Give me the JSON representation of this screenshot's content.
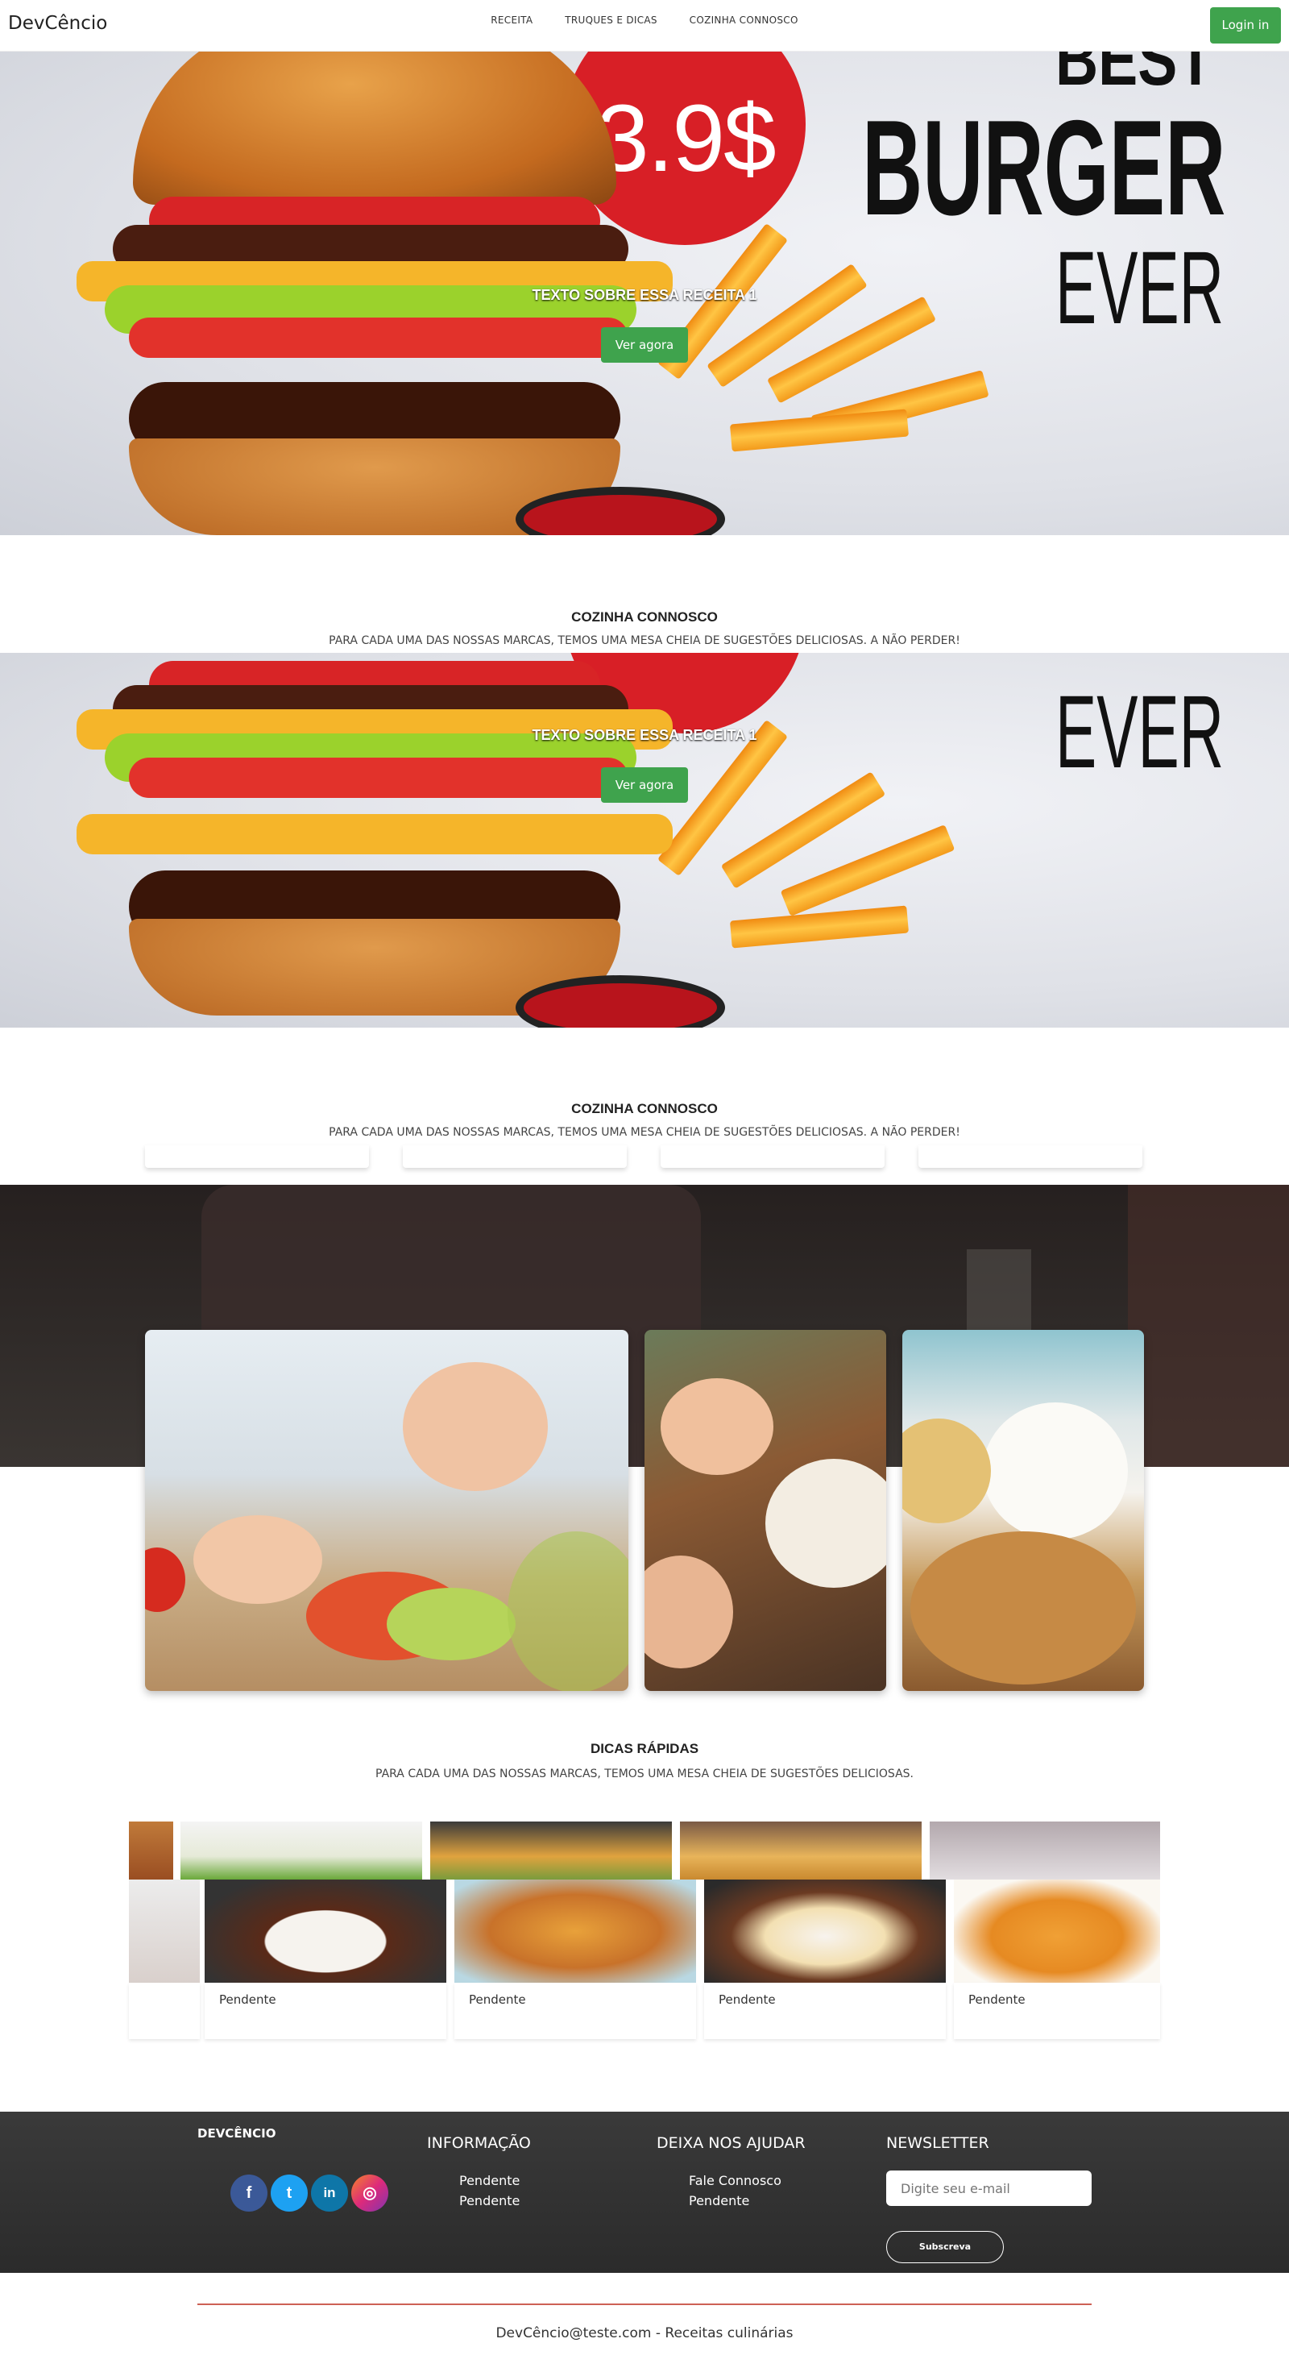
{
  "nav": {
    "brand": "DevCêncio",
    "items": [
      "RECEITA",
      "TRUQUES E DICAS",
      "COZINHA CONNOSCO"
    ],
    "login_label": "Login in"
  },
  "hero": {
    "price": "3.9$",
    "best": "BEST",
    "burger": "BURGER",
    "ever": "EVER",
    "caption": "TEXTO SOBRE ESSA RECEITA 1",
    "cta_label": "Ver agora"
  },
  "section1": {
    "title": "COZINHA CONNOSCO",
    "subtitle": "PARA CADA UMA DAS NOSSAS MARCAS, TEMOS UMA MESA CHEIA DE SUGESTÕES DELICIOSAS. A NÃO PERDER!"
  },
  "section2": {
    "title": "COZINHA CONNOSCO",
    "subtitle": "PARA CADA UMA DAS NOSSAS MARCAS, TEMOS UMA MESA CHEIA DE SUGESTÕES DELICIOSAS. A NÃO PERDER!"
  },
  "tips": {
    "title": "DICAS RÁPIDAS",
    "subtitle": "PARA CADA UMA DAS NOSSAS MARCAS, TEMOS UMA MESA CHEIA DE SUGESTÕES DELICIOSAS.",
    "cards": [
      {
        "label": "Pendente"
      },
      {
        "label": "Pendente"
      },
      {
        "label": "Pendente"
      },
      {
        "label": "Pendente"
      }
    ]
  },
  "footer": {
    "brand": "DEVCÊNCIO",
    "info_title": "INFORMAÇÃO",
    "info_links": [
      "Pendente",
      "Pendente"
    ],
    "help_title": "DEIXA NOS AJUDAR",
    "help_links": [
      "Fale Connosco",
      "Pendente"
    ],
    "newsletter_title": "NEWSLETTER",
    "email_placeholder": "Digite seu e-mail",
    "subscribe_label": "Subscreva",
    "social": [
      {
        "icon": "facebook-icon",
        "glyph": "f",
        "color": "#3b5998"
      },
      {
        "icon": "twitter-icon",
        "glyph": "t",
        "color": "#1da1f2"
      },
      {
        "icon": "linkedin-icon",
        "glyph": "in",
        "color": "#0e76a8"
      },
      {
        "icon": "instagram-icon",
        "glyph": "◎",
        "color": "#c13584"
      }
    ]
  },
  "copyright": "DevCêncio@teste.com - Receitas culinárias"
}
